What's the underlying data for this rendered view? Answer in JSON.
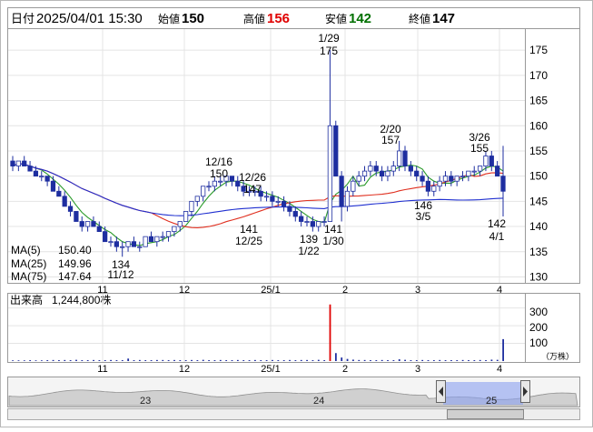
{
  "header": {
    "date_label": "日付",
    "date_value": "2025/04/01 15:30",
    "open_label": "始値",
    "open_value": "150",
    "high_label": "高値",
    "high_value": "156",
    "low_label": "安値",
    "low_value": "142",
    "close_label": "終値",
    "close_value": "147"
  },
  "colors": {
    "high": "#e00000",
    "low": "#007000",
    "candle": "#1e2ea0",
    "ma5": "#2a9a2a",
    "ma25": "#e03020",
    "ma75": "#2030d0",
    "volume": "#1e2ea0",
    "volume_spike": "#e00000",
    "nav_fill": "#8aa0f0"
  },
  "legend": [
    {
      "label": "MA(5)",
      "value": "150.40",
      "color": "#2a9a2a"
    },
    {
      "label": "MA(25)",
      "value": "149.96",
      "color": "#e03020"
    },
    {
      "label": "MA(75)",
      "value": "147.64",
      "color": "#2030d0"
    }
  ],
  "volume_panel": {
    "label": "出来高",
    "value": "1,244,800株",
    "unit": "（万株）",
    "ticks": [
      "300",
      "200",
      "100"
    ]
  },
  "navigator": {
    "year_labels": [
      "23",
      "24",
      "25"
    ],
    "left_arrow_icon": "chevron-left-icon",
    "right_arrow_icon": "chevron-right-icon"
  },
  "chart_data": {
    "type": "candlestick",
    "y_ticks": [
      175,
      170,
      165,
      160,
      155,
      150,
      145,
      140,
      135,
      130
    ],
    "ylim": [
      129,
      179
    ],
    "x_tick_labels": [
      "11",
      "12",
      "25/1",
      "2",
      "3",
      "4"
    ],
    "annotations": [
      {
        "date": "1/29",
        "value": "175",
        "position": "above"
      },
      {
        "date": "12/16",
        "value": "150",
        "position": "above"
      },
      {
        "date": "12/26",
        "value": "147",
        "position": "above"
      },
      {
        "date": "2/20",
        "value": "157",
        "position": "above"
      },
      {
        "date": "3/26",
        "value": "155",
        "position": "above"
      },
      {
        "date": "11/12",
        "value": "134",
        "position": "below"
      },
      {
        "date": "12/25",
        "value": "141",
        "position": "below"
      },
      {
        "date": "1/22",
        "value": "139",
        "position": "below"
      },
      {
        "date": "1/30",
        "value": "141",
        "position": "below"
      },
      {
        "date": "3/5",
        "value": "146",
        "position": "below"
      },
      {
        "date": "4/1",
        "value": "142",
        "position": "below"
      }
    ],
    "ohlc": [
      [
        153,
        154,
        151,
        152
      ],
      [
        152,
        153,
        151,
        153
      ],
      [
        153,
        154,
        152,
        152
      ],
      [
        152,
        153,
        151,
        151
      ],
      [
        151,
        152,
        150,
        150
      ],
      [
        150,
        151,
        149,
        150
      ],
      [
        150,
        150,
        148,
        149
      ],
      [
        149,
        150,
        147,
        147
      ],
      [
        147,
        148,
        146,
        146
      ],
      [
        146,
        147,
        144,
        144
      ],
      [
        144,
        145,
        142,
        143
      ],
      [
        143,
        143,
        141,
        141
      ],
      [
        141,
        142,
        139,
        140
      ],
      [
        140,
        141,
        139,
        141
      ],
      [
        141,
        142,
        140,
        140
      ],
      [
        140,
        141,
        139,
        139
      ],
      [
        139,
        140,
        137,
        137
      ],
      [
        137,
        138,
        136,
        137
      ],
      [
        137,
        138,
        135,
        136
      ],
      [
        136,
        137,
        134,
        136
      ],
      [
        136,
        137,
        135,
        137
      ],
      [
        137,
        138,
        136,
        136
      ],
      [
        136,
        137,
        135,
        136
      ],
      [
        136,
        138,
        136,
        138
      ],
      [
        138,
        139,
        137,
        137
      ],
      [
        137,
        138,
        136,
        138
      ],
      [
        138,
        139,
        137,
        138
      ],
      [
        138,
        139,
        137,
        139
      ],
      [
        139,
        140,
        138,
        140
      ],
      [
        140,
        141,
        139,
        141
      ],
      [
        141,
        143,
        141,
        143
      ],
      [
        143,
        145,
        142,
        145
      ],
      [
        145,
        146,
        144,
        146
      ],
      [
        146,
        148,
        145,
        148
      ],
      [
        148,
        149,
        147,
        148
      ],
      [
        148,
        150,
        147,
        149
      ],
      [
        149,
        150,
        148,
        149
      ],
      [
        149,
        150,
        148,
        150
      ],
      [
        150,
        150,
        148,
        149
      ],
      [
        149,
        150,
        147,
        148
      ],
      [
        148,
        149,
        146,
        147
      ],
      [
        147,
        148,
        146,
        147
      ],
      [
        147,
        148,
        146,
        147
      ],
      [
        147,
        148,
        145,
        146
      ],
      [
        146,
        147,
        145,
        146
      ],
      [
        146,
        147,
        144,
        145
      ],
      [
        145,
        146,
        144,
        145
      ],
      [
        145,
        146,
        143,
        144
      ],
      [
        144,
        145,
        142,
        143
      ],
      [
        143,
        144,
        141,
        142
      ],
      [
        142,
        143,
        140,
        141
      ],
      [
        141,
        142,
        140,
        141
      ],
      [
        141,
        142,
        139,
        140
      ],
      [
        140,
        141,
        139,
        141
      ],
      [
        141,
        142,
        140,
        141
      ],
      [
        141,
        175,
        141,
        160
      ],
      [
        160,
        161,
        150,
        150
      ],
      [
        150,
        151,
        141,
        144
      ],
      [
        144,
        148,
        143,
        147
      ],
      [
        147,
        150,
        146,
        149
      ],
      [
        149,
        151,
        148,
        150
      ],
      [
        150,
        152,
        149,
        151
      ],
      [
        151,
        153,
        150,
        152
      ],
      [
        152,
        153,
        150,
        151
      ],
      [
        151,
        152,
        149,
        150
      ],
      [
        150,
        152,
        149,
        151
      ],
      [
        151,
        153,
        150,
        152
      ],
      [
        152,
        157,
        151,
        155
      ],
      [
        155,
        156,
        151,
        152
      ],
      [
        152,
        153,
        150,
        151
      ],
      [
        151,
        152,
        149,
        150
      ],
      [
        150,
        151,
        148,
        149
      ],
      [
        149,
        150,
        146,
        147
      ],
      [
        147,
        149,
        146,
        148
      ],
      [
        148,
        150,
        147,
        149
      ],
      [
        149,
        151,
        148,
        150
      ],
      [
        150,
        151,
        148,
        149
      ],
      [
        149,
        150,
        148,
        150
      ],
      [
        150,
        151,
        149,
        150
      ],
      [
        150,
        151,
        149,
        151
      ],
      [
        151,
        152,
        150,
        151
      ],
      [
        151,
        152,
        150,
        152
      ],
      [
        152,
        155,
        151,
        154
      ],
      [
        154,
        155,
        151,
        152
      ],
      [
        152,
        153,
        150,
        150
      ],
      [
        150,
        156,
        142,
        147
      ]
    ],
    "volume_tenthousand": [
      4,
      4,
      4,
      5,
      4,
      4,
      5,
      6,
      5,
      6,
      5,
      7,
      5,
      5,
      6,
      5,
      5,
      6,
      5,
      5,
      14,
      5,
      6,
      5,
      5,
      6,
      6,
      5,
      6,
      5,
      5,
      6,
      5,
      7,
      5,
      5,
      6,
      5,
      5,
      6,
      5,
      5,
      6,
      5,
      5,
      6,
      5,
      5,
      6,
      5,
      6,
      6,
      5,
      7,
      5,
      320,
      45,
      20,
      12,
      8,
      6,
      6,
      5,
      5,
      6,
      5,
      5,
      10,
      7,
      5,
      5,
      6,
      5,
      5,
      6,
      5,
      5,
      5,
      6,
      5,
      5,
      6,
      5,
      8,
      7,
      124
    ]
  }
}
